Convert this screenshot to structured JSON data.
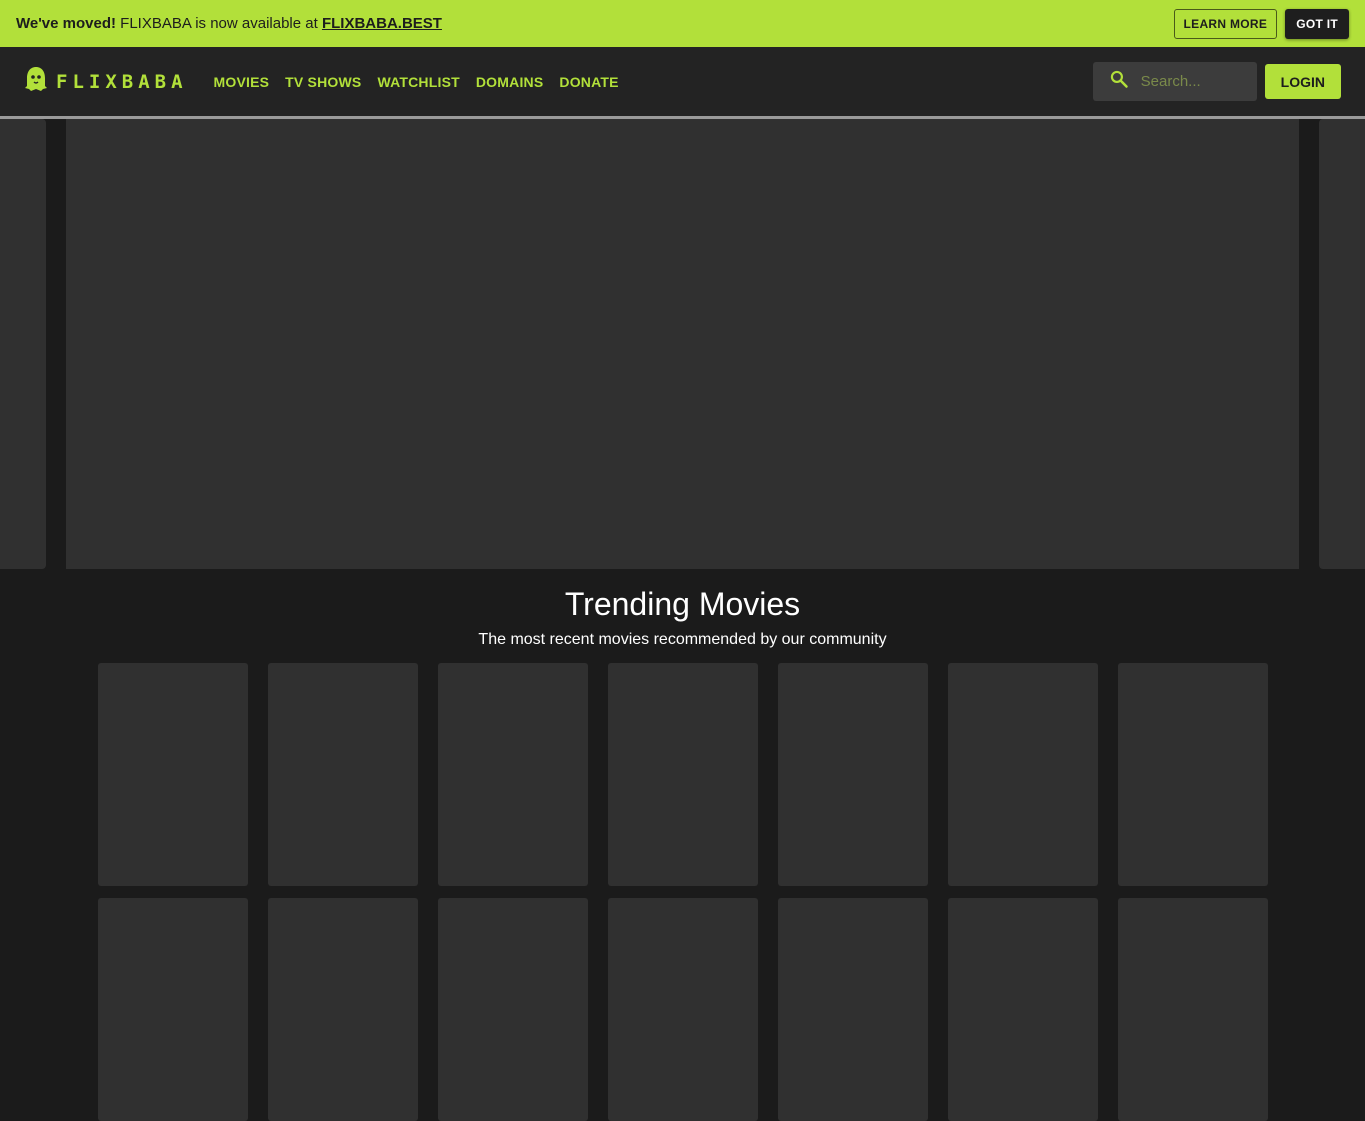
{
  "announcement": {
    "bold_text": "We've moved!",
    "text": " FLIXBABA is now available at ",
    "link_text": "FLIXBABA.BEST",
    "learn_more_label": "LEARN MORE",
    "got_it_label": "GOT IT"
  },
  "header": {
    "logo_text": "FLIXBABA",
    "nav": [
      "MOVIES",
      "TV SHOWS",
      "WATCHLIST",
      "DOMAINS",
      "DONATE"
    ],
    "search_placeholder": "Search...",
    "login_label": "LOGIN"
  },
  "trending": {
    "title": "Trending Movies",
    "subtitle": "The most recent movies recommended by our community"
  },
  "colors": {
    "accent": "#b2e03a",
    "background": "#1b1b1b",
    "header": "#232323",
    "placeholder_card": "#303030"
  },
  "icons": {
    "logo": "ghost-logo-icon",
    "search": "search-icon"
  }
}
